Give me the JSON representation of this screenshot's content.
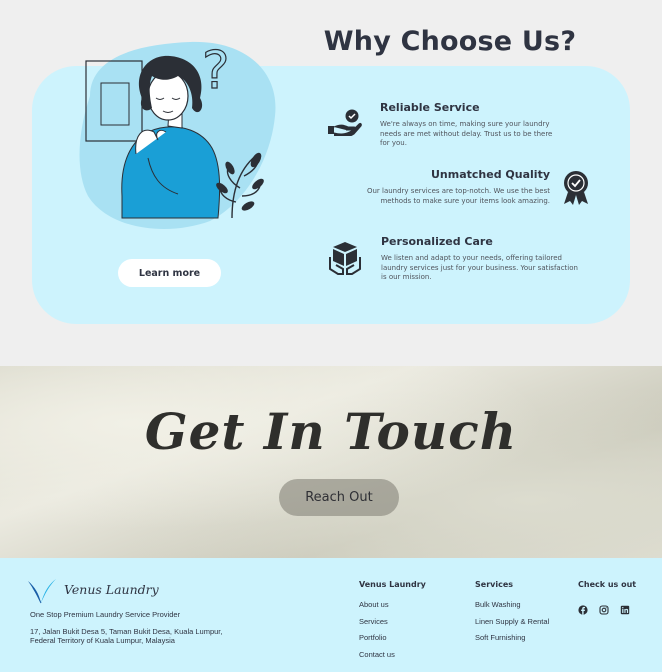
{
  "why": {
    "title": "Why Choose Us?",
    "learn_more": "Learn more",
    "features": [
      {
        "title": "Reliable Service",
        "desc": "We're always on time, making sure your laundry needs are met without delay. Trust us to be there for you.",
        "icon": "hand-check-icon"
      },
      {
        "title": "Unmatched Quality",
        "desc": "Our laundry services are top-notch. We use the best methods to make sure your items look amazing.",
        "icon": "award-badge-icon"
      },
      {
        "title": "Personalized Care",
        "desc": "We listen and adapt to your needs, offering tailored laundry services just for your business. Your satisfaction is our mission.",
        "icon": "hands-box-icon"
      }
    ]
  },
  "touch": {
    "title": "Get In Touch",
    "button": "Reach Out"
  },
  "footer": {
    "brand": "Venus Laundry",
    "tagline": "One Stop Premium Laundry Service Provider",
    "address": "17, Jalan Bukit Desa 5, Taman Bukit Desa, Kuala Lumpur, Federal Territory of Kuala Lumpur, Malaysia",
    "col1": {
      "heading": "Venus Laundry",
      "links": [
        "About us",
        "Services",
        "Portfolio",
        "Contact us"
      ]
    },
    "col2": {
      "heading": "Services",
      "links": [
        "Bulk Washing",
        "Linen Supply & Rental",
        "Soft Furnishing"
      ]
    },
    "col3": {
      "heading": "Check us out",
      "icons": [
        "facebook-icon",
        "instagram-icon",
        "linkedin-icon"
      ]
    }
  },
  "colors": {
    "card_bg": "#cdf3fd",
    "accent_blue": "#1a9fd6",
    "text_dark": "#2f3442"
  }
}
